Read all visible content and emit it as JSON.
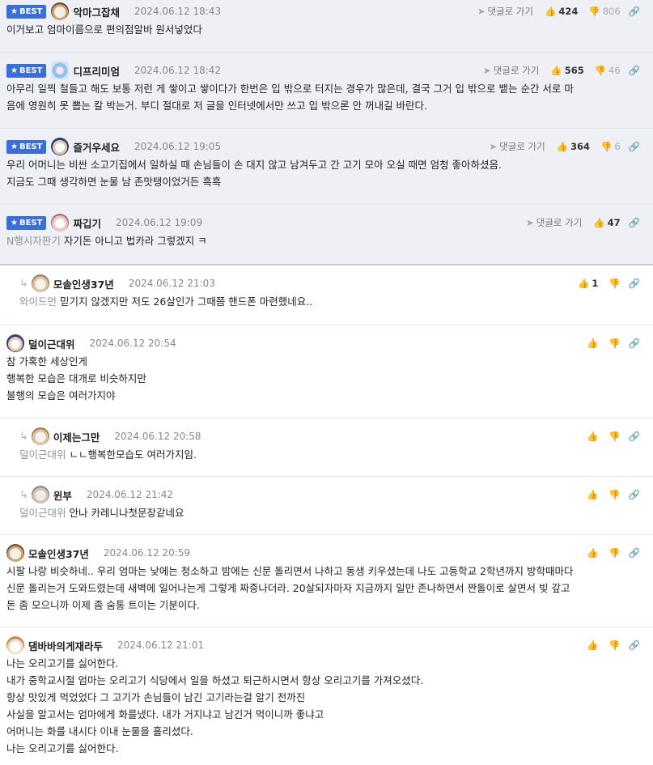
{
  "ui": {
    "best_label": "BEST",
    "reply_link_label": "댓글로 가기",
    "star": "★",
    "reply_arrow": "↳",
    "thumb_up_icon": "👍",
    "thumb_down_icon": "👎",
    "link_icon": "🔗"
  },
  "comments": [
    {
      "nick": "악마그잡채",
      "date": "2024.06.12 18:43",
      "up": "424",
      "down": "806",
      "lines": [
        "이거보고 엄마이름으로 편의점알바 원서넣었다"
      ]
    },
    {
      "nick": "디프리미엄",
      "date": "2024.06.12 18:42",
      "up": "565",
      "down": "46",
      "lines": [
        "아무리 일찍 철들고 해도 보통 저런 게 쌓이고 쌓이다가 한번은 입 밖으로 터지는 경우가 많은데, 결국 그거 입 밖으로 뱉는 순간 서로 마",
        "음에 영원히 못 뽑는 칼 박는거. 부디 절대로 저 글을 인터넷에서만 쓰고 입 밖으론 안 꺼내길 바란다."
      ]
    },
    {
      "nick": "즐거우세요",
      "date": "2024.06.12 19:05",
      "up": "364",
      "down": "6",
      "lines": [
        "우리 어머니는 비싼 소고기집에서 일하실 때 손님들이 손 대지 않고 남겨두고 간 고기 모아 오실 때면 엄청 좋아하셨음.",
        "지금도 그때 생각하면 눈물 남 존맛탱이었거든 흑흑"
      ]
    },
    {
      "nick": "짜깁기",
      "date": "2024.06.12 19:09",
      "up": "47",
      "down": "",
      "mention": "N행시자판기",
      "lines": [
        "자기돈 아니고 법카라 그렇겠지 ㅋ"
      ]
    },
    {
      "nick": "모솔인생37년",
      "date": "2024.06.12 21:03",
      "up": "1",
      "down": "",
      "mention": "와이드먼",
      "lines": [
        "믿기지 않겠지만 저도 26살인가 그때쯤 핸드폰 마련했네요.."
      ]
    },
    {
      "nick": "덜이근대위",
      "date": "2024.06.12 20:54",
      "up": "",
      "down": "",
      "lines": [
        "참 가혹한 세상인게",
        "행복한 모습은 대개로 비슷하지만",
        "불행의 모습은 여러가지야"
      ]
    },
    {
      "nick": "이제는그만",
      "date": "2024.06.12 20:58",
      "up": "",
      "down": "",
      "mention": "덜이근대위",
      "lines": [
        "ㄴㄴ행복한모습도 여러가지임."
      ]
    },
    {
      "nick": "윈부",
      "date": "2024.06.12 21:42",
      "up": "",
      "down": "",
      "mention": "덜이근대위",
      "lines": [
        "안나 카레니나첫문장같네요"
      ]
    },
    {
      "nick": "모솔인생37년",
      "date": "2024.06.12 20:59",
      "up": "",
      "down": "",
      "lines": [
        "시팔 나랑 비슷하네.. 우리 엄마는 낮에는 청소하고 밤에는 신문 돌리면서 나하고 동생 키우셨는데 나도 고등학교 2학년까지 방학때마다",
        "신문 돌리는거 도와드렸는데 새벽에 일어나는게 그렇게 짜증나더라. 20살되자마자 지금까지 일만 존나하면서 짠돌이로 살면서 빚 갚고",
        "돈 좀 모으니까 이제 좀 숨통 트이는 기분이다."
      ]
    },
    {
      "nick": "댐바바의게재라두",
      "date": "2024.06.12 21:01",
      "up": "",
      "down": "",
      "lines": [
        "나는 오리고기를 싫어한다.",
        "내가 중학교시절 엄마는 오리고기 식당에서 일을 하셨고 퇴근하시면서 항상 오리고기를 가져오셨다.",
        "항상 맛있게 먹었었다 그 고기가 손님들이 남긴 고기라는걸 알기 전까진",
        "사실을 알고서는 엄마에게 화를냈다. 내가 거지냐고 남긴거 먹이니까 좋냐고",
        "어머니는 화를 내시다 이내 눈물을 흘리셨다.",
        "나는 오리고기를 싫어한다."
      ]
    }
  ]
}
